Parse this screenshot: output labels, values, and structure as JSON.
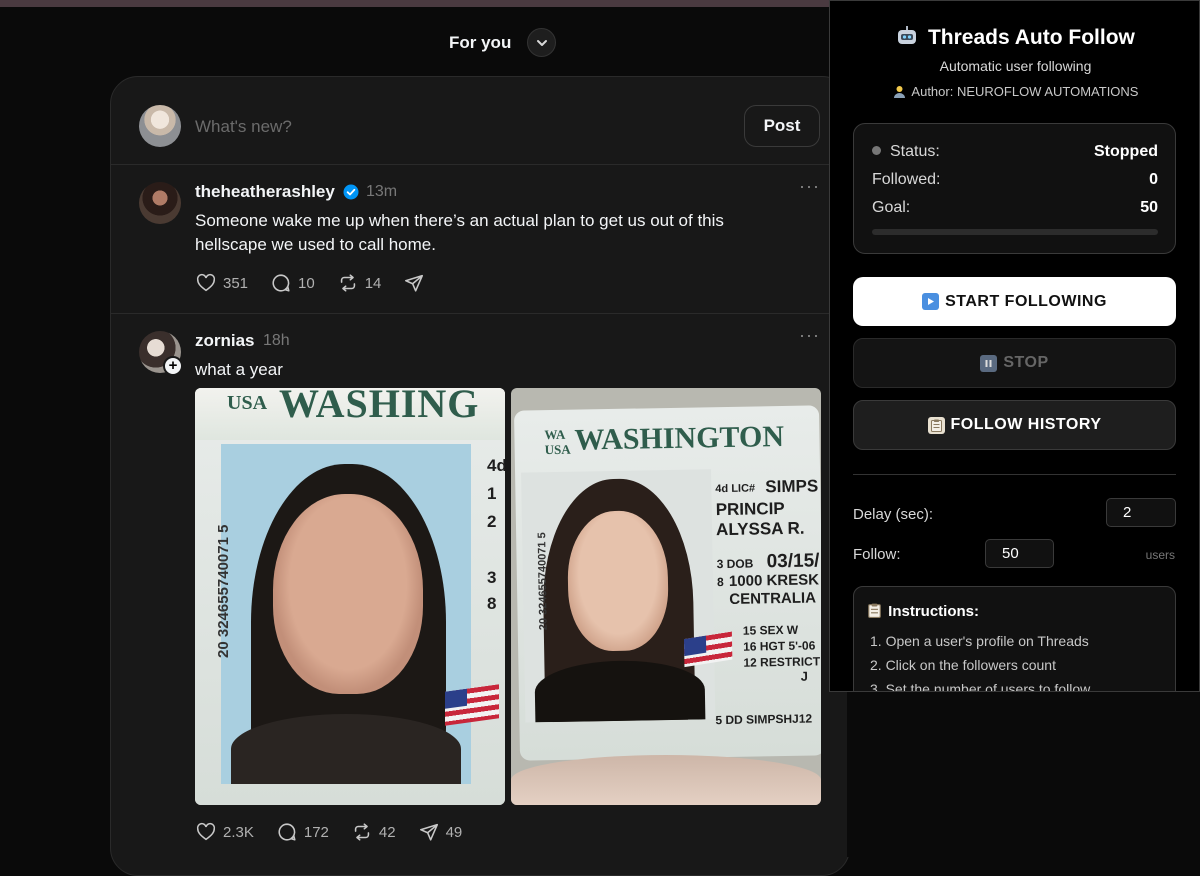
{
  "feed": {
    "title": "For you",
    "composer_placeholder": "What's new?",
    "post_label": "Post"
  },
  "posts": [
    {
      "username": "theheatherashley",
      "time": "13m",
      "text": "Someone wake me up when there’s an actual plan to get us out of this hellscape we used to call home.",
      "likes": "351",
      "replies": "10",
      "reposts": "14"
    },
    {
      "username": "zornias",
      "time": "18h",
      "text": "what a year",
      "likes": "2.3K",
      "replies": "172",
      "reposts": "42",
      "shares": "49",
      "images": [
        {
          "header_usa": "USA",
          "header_state": "WASHING",
          "fields": [
            "4d",
            "1",
            "2",
            "3",
            "8"
          ],
          "vertical_number": "20 324655740071 5"
        },
        {
          "header_wa": "WA",
          "header_usa": "USA",
          "header_state": "WASHINGTON",
          "vertical_number": "20 324655740071 5",
          "lic_prefix": "4d LIC#",
          "lic": "SIMPS",
          "line1": "PRINCIP",
          "line2": "ALYSSA R.",
          "dob_prefix": "3 DOB",
          "dob": "03/15/",
          "address_prefix": "8",
          "address": "1000 KRESK",
          "city": "CENTRALIA",
          "sex": "15 SEX W",
          "hgt": "16 HGT 5'-06",
          "restrict": "12 RESTRICT",
          "restrict_val": "J",
          "dd": "5 DD SIMPSHJ12"
        }
      ]
    }
  ],
  "panel": {
    "title": "Threads Auto Follow",
    "subtitle": "Automatic user following",
    "author": "Author: NEUROFLOW AUTOMATIONS",
    "status_label": "Status:",
    "status_value": "Stopped",
    "followed_label": "Followed:",
    "followed_value": "0",
    "goal_label": "Goal:",
    "goal_value": "50",
    "progress_fraction": 0,
    "start_label": "START FOLLOWING",
    "stop_label": "STOP",
    "history_label": "FOLLOW HISTORY",
    "delay_label": "Delay (sec):",
    "delay_value": "2",
    "follow_label": "Follow:",
    "follow_value": "50",
    "follow_unit": "users",
    "instructions_title": "Instructions:",
    "instructions": [
      "1. Open a user's profile on Threads",
      "2. Click on the followers count",
      "3. Set the number of users to follow"
    ]
  },
  "colors": {
    "background": "#0a0a0a",
    "card": "#181818",
    "verified": "#0095f6",
    "panel_bg": "#000000"
  }
}
